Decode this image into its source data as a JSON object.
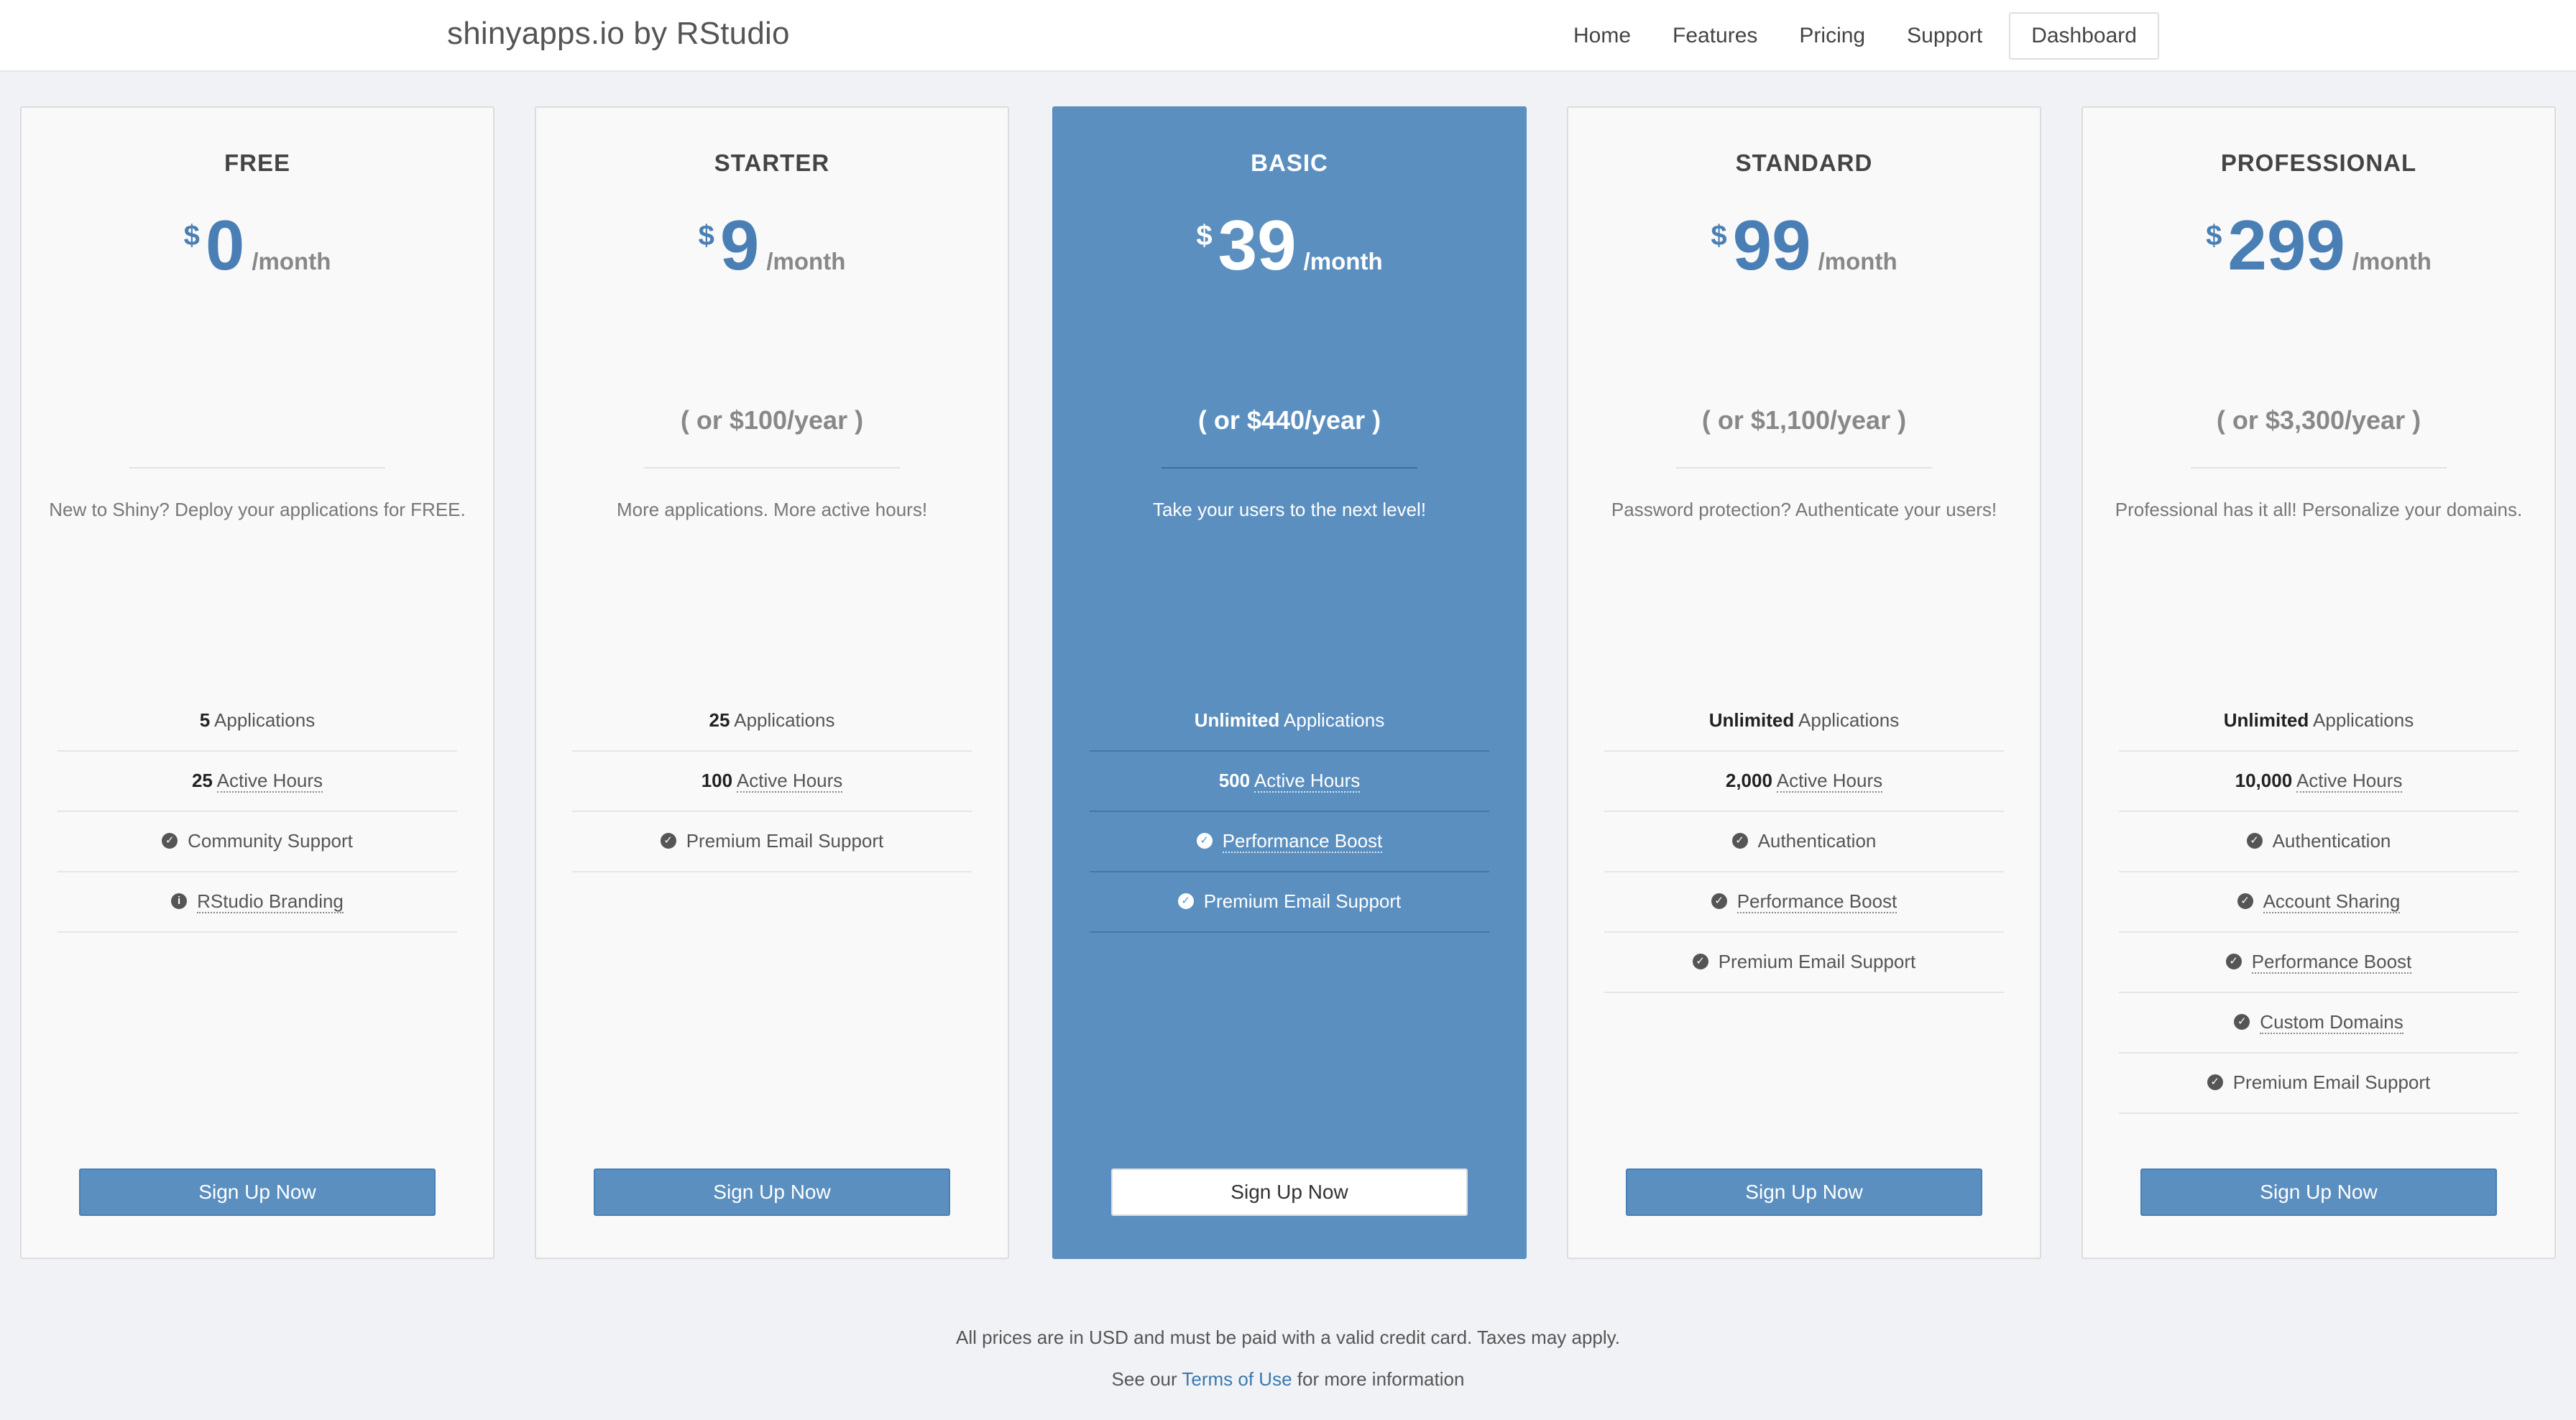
{
  "header": {
    "brand": "shinyapps.io by RStudio",
    "nav": [
      "Home",
      "Features",
      "Pricing",
      "Support",
      "Dashboard"
    ]
  },
  "colors": {
    "accent": "#5b8fbf",
    "page_bg": "#f1f2f6",
    "card_bg": "#f9f9f9"
  },
  "plans": [
    {
      "name": "FREE",
      "currency": "$",
      "price": "0",
      "per": "/month",
      "yearly": "",
      "description": "New to Shiny? Deploy your applications for FREE.",
      "features": [
        {
          "bold": "5",
          "text": "Applications",
          "icon": "",
          "underline": false
        },
        {
          "bold": "25",
          "text": "Active Hours",
          "icon": "",
          "underline": true
        },
        {
          "bold": "",
          "text": "Community Support",
          "icon": "check-circle",
          "underline": false
        },
        {
          "bold": "",
          "text": "RStudio Branding",
          "icon": "info-circle",
          "underline": true
        }
      ],
      "button": "Sign Up Now"
    },
    {
      "name": "STARTER",
      "currency": "$",
      "price": "9",
      "per": "/month",
      "yearly": "( or $100/year )",
      "description": "More applications. More active hours!",
      "features": [
        {
          "bold": "25",
          "text": "Applications",
          "icon": "",
          "underline": false
        },
        {
          "bold": "100",
          "text": "Active Hours",
          "icon": "",
          "underline": true
        },
        {
          "bold": "",
          "text": "Premium Email Support",
          "icon": "check-circle",
          "underline": false
        }
      ],
      "button": "Sign Up Now"
    },
    {
      "name": "BASIC",
      "currency": "$",
      "price": "39",
      "per": "/month",
      "yearly": "( or $440/year )",
      "description": "Take your users to the next level!",
      "featured": true,
      "features": [
        {
          "bold": "Unlimited",
          "text": "Applications",
          "icon": "",
          "underline": false
        },
        {
          "bold": "500",
          "text": "Active Hours",
          "icon": "",
          "underline": true
        },
        {
          "bold": "",
          "text": "Performance Boost",
          "icon": "check-circle",
          "underline": true
        },
        {
          "bold": "",
          "text": "Premium Email Support",
          "icon": "check-circle",
          "underline": false
        }
      ],
      "button": "Sign Up Now"
    },
    {
      "name": "STANDARD",
      "currency": "$",
      "price": "99",
      "per": "/month",
      "yearly": "( or $1,100/year )",
      "description": "Password protection? Authenticate your users!",
      "features": [
        {
          "bold": "Unlimited",
          "text": "Applications",
          "icon": "",
          "underline": false
        },
        {
          "bold": "2,000",
          "text": "Active Hours",
          "icon": "",
          "underline": true
        },
        {
          "bold": "",
          "text": "Authentication",
          "icon": "check-circle",
          "underline": false
        },
        {
          "bold": "",
          "text": "Performance Boost",
          "icon": "check-circle",
          "underline": true
        },
        {
          "bold": "",
          "text": "Premium Email Support",
          "icon": "check-circle",
          "underline": false
        }
      ],
      "button": "Sign Up Now"
    },
    {
      "name": "PROFESSIONAL",
      "currency": "$",
      "price": "299",
      "per": "/month",
      "yearly": "( or $3,300/year )",
      "description": "Professional has it all! Personalize your domains.",
      "features": [
        {
          "bold": "Unlimited",
          "text": "Applications",
          "icon": "",
          "underline": false
        },
        {
          "bold": "10,000",
          "text": "Active Hours",
          "icon": "",
          "underline": true
        },
        {
          "bold": "",
          "text": "Authentication",
          "icon": "check-circle",
          "underline": false
        },
        {
          "bold": "",
          "text": "Account Sharing",
          "icon": "check-circle",
          "underline": true
        },
        {
          "bold": "",
          "text": "Performance Boost",
          "icon": "check-circle",
          "underline": true
        },
        {
          "bold": "",
          "text": "Custom Domains",
          "icon": "check-circle",
          "underline": true
        },
        {
          "bold": "",
          "text": "Premium Email Support",
          "icon": "check-circle",
          "underline": false
        }
      ],
      "button": "Sign Up Now"
    }
  ],
  "footer": {
    "note": "All prices are in USD and must be paid with a valid credit card. Taxes may apply.",
    "see_prefix": "See our",
    "terms_link": "Terms of Use",
    "see_suffix": "for more information"
  }
}
